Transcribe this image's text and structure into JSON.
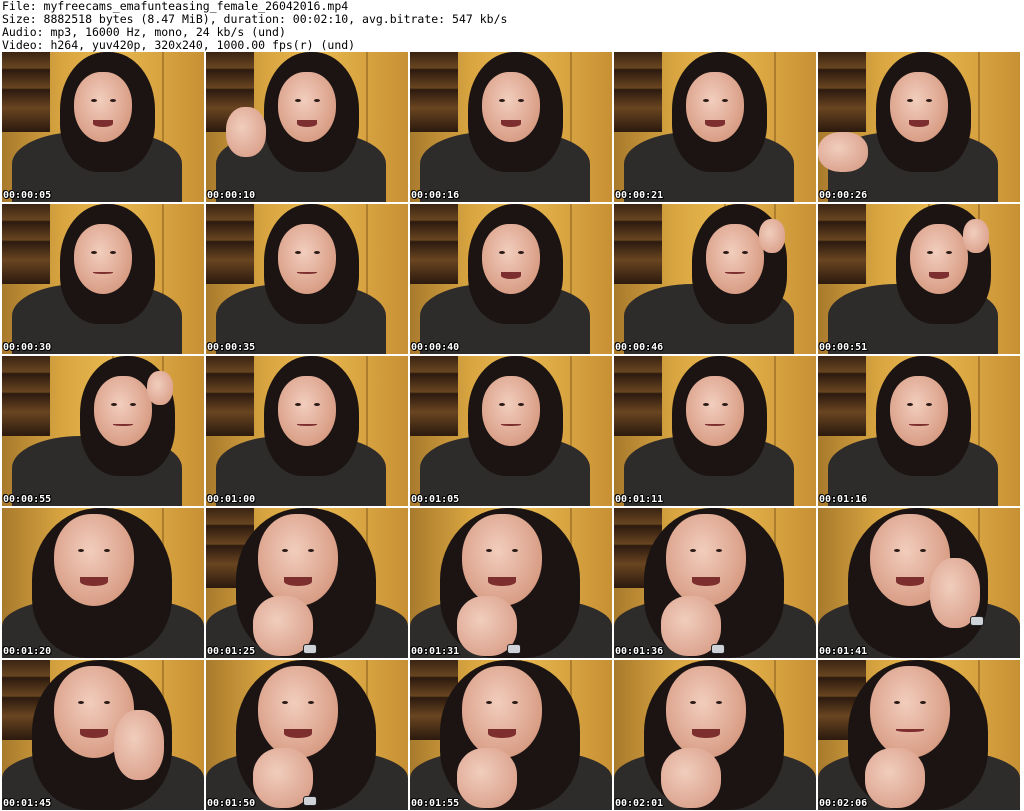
{
  "header": {
    "line1": "File: myfreecams_emafunteasing_female_26042016.mp4",
    "line2": "Size: 8882518 bytes (8.47 MiB), duration: 00:02:10, avg.bitrate: 547 kb/s",
    "line3": "Audio: mp3, 16000 Hz, mono, 24 kb/s (und)",
    "line4": "Video: h264, yuv420p, 320x240, 1000.00 fps(r) (und)"
  },
  "frames": [
    {
      "time": "00:00:05",
      "pose": "smile",
      "hand": "none"
    },
    {
      "time": "00:00:10",
      "pose": "smile",
      "hand": "wave"
    },
    {
      "time": "00:00:16",
      "pose": "smile",
      "hand": "none"
    },
    {
      "time": "00:00:21",
      "pose": "smile",
      "hand": "none"
    },
    {
      "time": "00:00:26",
      "pose": "smile",
      "hand": "wave-low"
    },
    {
      "time": "00:00:30",
      "pose": "neutral",
      "hand": "none"
    },
    {
      "time": "00:00:35",
      "pose": "neutral",
      "hand": "none"
    },
    {
      "time": "00:00:40",
      "pose": "smile",
      "hand": "none"
    },
    {
      "time": "00:00:46",
      "pose": "neutral",
      "hand": "hair"
    },
    {
      "time": "00:00:51",
      "pose": "smile",
      "hand": "hair"
    },
    {
      "time": "00:00:55",
      "pose": "neutral",
      "hand": "hair"
    },
    {
      "time": "00:01:00",
      "pose": "neutral",
      "hand": "none"
    },
    {
      "time": "00:01:05",
      "pose": "neutral",
      "hand": "none"
    },
    {
      "time": "00:01:11",
      "pose": "neutral",
      "hand": "none"
    },
    {
      "time": "00:01:16",
      "pose": "neutral",
      "hand": "none"
    },
    {
      "time": "00:01:20",
      "pose": "close-smile",
      "hand": "none"
    },
    {
      "time": "00:01:25",
      "pose": "close-smile",
      "hand": "chin-watch"
    },
    {
      "time": "00:01:31",
      "pose": "close-smile",
      "hand": "chin-watch"
    },
    {
      "time": "00:01:36",
      "pose": "close-smile",
      "hand": "chin-watch"
    },
    {
      "time": "00:01:41",
      "pose": "close-smile",
      "hand": "cheek-watch"
    },
    {
      "time": "00:01:45",
      "pose": "close-smile",
      "hand": "cheek"
    },
    {
      "time": "00:01:50",
      "pose": "close-smile",
      "hand": "chin-watch"
    },
    {
      "time": "00:01:55",
      "pose": "close-smile",
      "hand": "chin"
    },
    {
      "time": "00:02:01",
      "pose": "close-smile",
      "hand": "chin"
    },
    {
      "time": "00:02:06",
      "pose": "close-neutral",
      "hand": "chin"
    }
  ],
  "colors": {
    "wood": "#d7a63f",
    "hair": "#1b1413",
    "jacket": "#2e2c2b",
    "skin": "#e7b7a2"
  }
}
